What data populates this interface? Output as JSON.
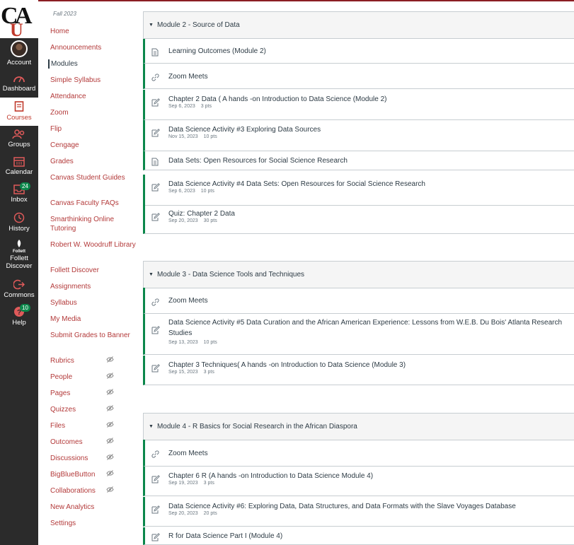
{
  "global_nav": {
    "logo_text": "CAU",
    "items": [
      {
        "label": "Account",
        "icon": "avatar"
      },
      {
        "label": "Dashboard",
        "icon": "dashboard-icon"
      },
      {
        "label": "Courses",
        "icon": "courses-icon"
      },
      {
        "label": "Groups",
        "icon": "groups-icon"
      },
      {
        "label": "Calendar",
        "icon": "calendar-icon"
      },
      {
        "label": "Inbox",
        "icon": "inbox-icon",
        "badge": "24"
      },
      {
        "label": "History",
        "icon": "history-icon"
      },
      {
        "label": "Follett Discover",
        "icon": "follett-icon",
        "icon_text": "Follett"
      },
      {
        "label": "Commons",
        "icon": "commons-icon"
      },
      {
        "label": "Help",
        "icon": "help-icon",
        "badge": "10"
      }
    ]
  },
  "course_nav": {
    "term": "Fall 2023",
    "items": [
      {
        "label": "Home"
      },
      {
        "label": "Announcements"
      },
      {
        "label": "Modules"
      },
      {
        "label": "Simple Syllabus"
      },
      {
        "label": "Attendance"
      },
      {
        "label": "Zoom"
      },
      {
        "label": "Flip"
      },
      {
        "label": "Cengage"
      },
      {
        "label": "Grades"
      },
      {
        "label": "Canvas Student Guides"
      },
      {
        "label": "Canvas Faculty FAQs"
      },
      {
        "label": "Smarthinking Online Tutoring"
      },
      {
        "label": "Robert W. Woodruff Library"
      },
      {
        "label": "Follett Discover"
      },
      {
        "label": "Assignments"
      },
      {
        "label": "Syllabus"
      },
      {
        "label": "My Media"
      },
      {
        "label": "Submit Grades to Banner"
      },
      {
        "label": "Rubrics"
      },
      {
        "label": "People"
      },
      {
        "label": "Pages"
      },
      {
        "label": "Quizzes"
      },
      {
        "label": "Files"
      },
      {
        "label": "Outcomes"
      },
      {
        "label": "Discussions"
      },
      {
        "label": "BigBlueButton"
      },
      {
        "label": "Collaborations"
      },
      {
        "label": "New Analytics"
      },
      {
        "label": "Settings"
      }
    ]
  },
  "modules": [
    {
      "title": "Module 2 - Source of Data",
      "items": [
        {
          "title": "Learning Outcomes (Module 2)",
          "icon": "page-icon"
        },
        {
          "title": "Zoom Meets",
          "icon": "link-icon"
        },
        {
          "title": "Chapter 2 Data ( A hands -on Introduction to Data Science (Module 2)",
          "icon": "assignment-icon",
          "date": "Sep 6, 2023",
          "points": "3 pts"
        },
        {
          "title": "Data Science Activity #3 Exploring Data Sources",
          "icon": "assignment-icon",
          "date": "Nov 15, 2023",
          "points": "10 pts"
        },
        {
          "title": "Data Sets: Open Resources for Social Science Research",
          "icon": "page-icon"
        },
        {
          "title": "Data Science Activity #4 Data Sets: Open Resources for Social Science Research",
          "icon": "assignment-icon",
          "date": "Sep 6, 2023",
          "points": "10 pts"
        },
        {
          "title": "Quiz: Chapter 2 Data",
          "icon": "assignment-icon",
          "date": "Sep 20, 2023",
          "points": "30 pts"
        }
      ]
    },
    {
      "title": "Module 3 - Data Science Tools and Techniques",
      "items": [
        {
          "title": "Zoom Meets",
          "icon": "link-icon"
        },
        {
          "title": "Data Science Activity #5 Data Curation and the African American Experience: Lessons from W.E.B. Du Bois' Atlanta Research Studies",
          "icon": "assignment-icon",
          "date": "Sep 13, 2023",
          "points": "10 pts"
        },
        {
          "title": "Chapter 3 Techniques( A hands -on Introduction to Data Science (Module 3)",
          "icon": "assignment-icon",
          "date": "Sep 15, 2023",
          "points": "3 pts"
        }
      ]
    },
    {
      "title": "Module 4 - R Basics for Social Research in the African Diaspora",
      "items": [
        {
          "title": "Zoom Meets",
          "icon": "link-icon"
        },
        {
          "title": "Chapter 6 R (A hands -on Introduction to Data Science Module 4)",
          "icon": "assignment-icon",
          "date": "Sep 19, 2023",
          "points": "3 pts"
        },
        {
          "title": "Data Science Activity #6: Exploring Data, Data Structures, and Data Formats with the Slave Voyages Database",
          "icon": "assignment-icon",
          "date": "Sep 20, 2023",
          "points": "20 pts"
        },
        {
          "title": "R for Data Science Part I (Module 4)",
          "icon": "assignment-icon"
        }
      ]
    }
  ],
  "colors": {
    "brand": "#8b1e24",
    "link": "#b33a3a",
    "published": "#0b874b",
    "nav_bg": "#2b2b2b"
  }
}
